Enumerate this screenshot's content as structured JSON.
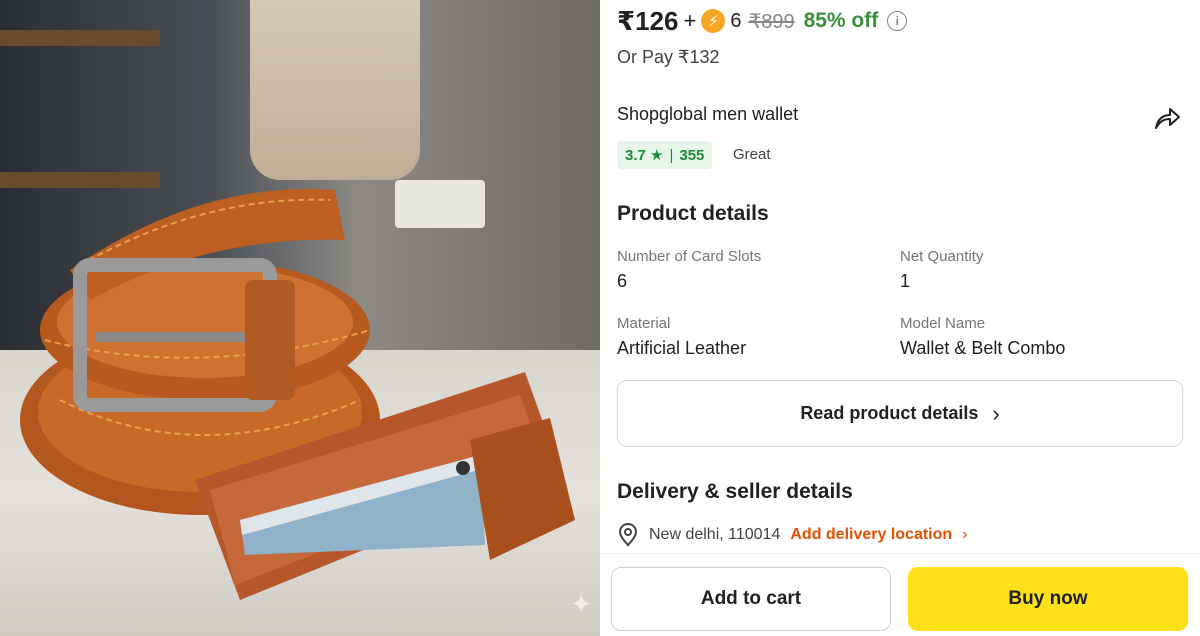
{
  "product_image": {
    "alt_name": "wallet-and-belt-photo"
  },
  "price": {
    "current": "₹126",
    "plus": "+",
    "coin_count": "6",
    "mrp": "₹899",
    "discount": "85% off",
    "alt_pay": "Or Pay ₹132",
    "colors": {
      "discount": "#388e3c",
      "coin": "#f6a623"
    }
  },
  "product": {
    "title": "Shopglobal men wallet",
    "rating": "3.7 ★",
    "rating_sep": "|",
    "rating_count": "355",
    "rating_word": "Great"
  },
  "details": {
    "heading": "Product details",
    "specs": [
      {
        "label": "Number of Card Slots",
        "value": "6"
      },
      {
        "label": "Net Quantity",
        "value": "1"
      },
      {
        "label": "Material",
        "value": "Artificial Leather"
      },
      {
        "label": "Model Name",
        "value": "Wallet & Belt Combo"
      }
    ],
    "read_more": "Read product details",
    "read_more_chevron": "›"
  },
  "delivery": {
    "heading": "Delivery & seller details",
    "location": "New delhi, 110014",
    "add_location": "Add delivery location",
    "chevron": "›",
    "colors": {
      "link": "#e65100"
    }
  },
  "actions": {
    "add_to_cart": "Add to cart",
    "buy_now": "Buy now",
    "colors": {
      "buy": "#ffe11b"
    }
  }
}
